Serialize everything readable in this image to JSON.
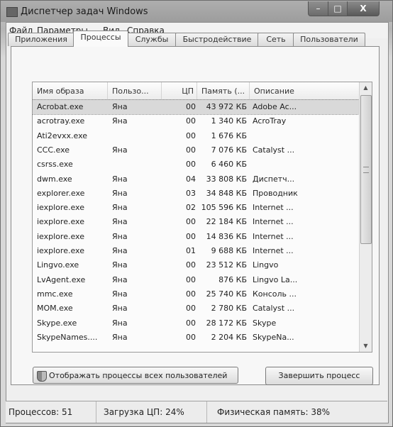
{
  "window": {
    "title": "Диспетчер задач Windows",
    "buttons": {
      "minimize": "–",
      "maximize": "□",
      "close": "X"
    }
  },
  "menu": [
    "Файл",
    "Параметры",
    "Вид",
    "Справка"
  ],
  "tabs": [
    {
      "label": "Приложения",
      "active": false
    },
    {
      "label": "Процессы",
      "active": true
    },
    {
      "label": "Службы",
      "active": false
    },
    {
      "label": "Быстродействие",
      "active": false
    },
    {
      "label": "Сеть",
      "active": false
    },
    {
      "label": "Пользователи",
      "active": false
    }
  ],
  "columns": [
    "Имя образа",
    "Пользо...",
    "ЦП",
    "Память (...",
    "Описание"
  ],
  "processes": [
    {
      "name": "Acrobat.exe",
      "user": "Яна",
      "cpu": "00",
      "mem": "43 972 КБ",
      "desc": "Adobe Ac...",
      "selected": true
    },
    {
      "name": "acrotray.exe",
      "user": "Яна",
      "cpu": "00",
      "mem": "1 340 КБ",
      "desc": "AcroTray"
    },
    {
      "name": "Ati2evxx.exe",
      "user": "",
      "cpu": "00",
      "mem": "1 676 КБ",
      "desc": ""
    },
    {
      "name": "CCC.exe",
      "user": "Яна",
      "cpu": "00",
      "mem": "7 076 КБ",
      "desc": "Catalyst ..."
    },
    {
      "name": "csrss.exe",
      "user": "",
      "cpu": "00",
      "mem": "6 460 КБ",
      "desc": ""
    },
    {
      "name": "dwm.exe",
      "user": "Яна",
      "cpu": "04",
      "mem": "33 808 КБ",
      "desc": "Диспетч..."
    },
    {
      "name": "explorer.exe",
      "user": "Яна",
      "cpu": "03",
      "mem": "34 848 КБ",
      "desc": "Проводник"
    },
    {
      "name": "iexplore.exe",
      "user": "Яна",
      "cpu": "02",
      "mem": "105 596 КБ",
      "desc": "Internet ..."
    },
    {
      "name": "iexplore.exe",
      "user": "Яна",
      "cpu": "00",
      "mem": "22 184 КБ",
      "desc": "Internet ..."
    },
    {
      "name": "iexplore.exe",
      "user": "Яна",
      "cpu": "00",
      "mem": "14 836 КБ",
      "desc": "Internet ..."
    },
    {
      "name": "iexplore.exe",
      "user": "Яна",
      "cpu": "01",
      "mem": "9 688 КБ",
      "desc": "Internet ..."
    },
    {
      "name": "Lingvo.exe",
      "user": "Яна",
      "cpu": "00",
      "mem": "23 512 КБ",
      "desc": "Lingvo"
    },
    {
      "name": "LvAgent.exe",
      "user": "Яна",
      "cpu": "00",
      "mem": "876 КБ",
      "desc": "Lingvo La..."
    },
    {
      "name": "mmc.exe",
      "user": "Яна",
      "cpu": "00",
      "mem": "25 740 КБ",
      "desc": "Консоль ..."
    },
    {
      "name": "MOM.exe",
      "user": "Яна",
      "cpu": "00",
      "mem": "2 780 КБ",
      "desc": "Catalyst ..."
    },
    {
      "name": "Skype.exe",
      "user": "Яна",
      "cpu": "00",
      "mem": "28 172 КБ",
      "desc": "Skype"
    },
    {
      "name": "SkypeNames....",
      "user": "Яна",
      "cpu": "00",
      "mem": "2 204 КБ",
      "desc": "SkypeNa..."
    }
  ],
  "buttons": {
    "show_all": "Отображать процессы всех пользователей",
    "end_process": "Завершить процесс"
  },
  "status": {
    "processes": "Процессов: 51",
    "cpu": "Загрузка ЦП: 24%",
    "memory": "Физическая память: 38%"
  },
  "icons": {
    "title": "task-manager-icon",
    "show_all": "shield-icon"
  }
}
